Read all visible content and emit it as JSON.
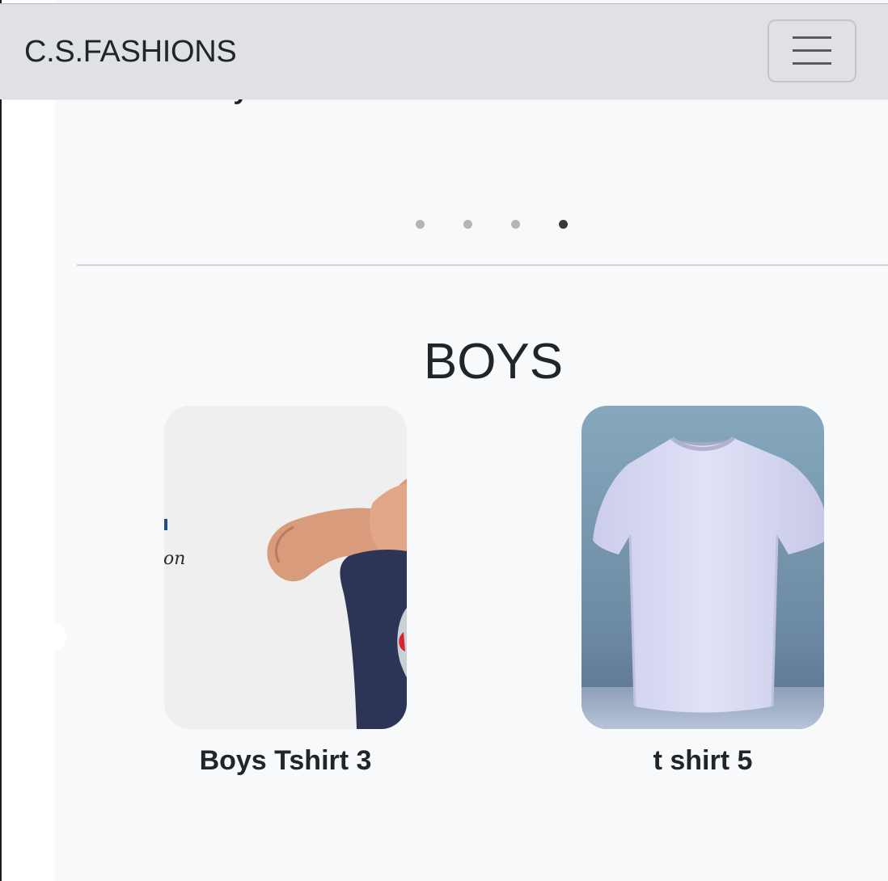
{
  "navbar": {
    "brand": "C.S.FASHIONS",
    "toggle_icon": "hamburger-menu-icon"
  },
  "carousel": {
    "peek_titles": [
      "Boys Tshirt 3",
      "t shirt 5"
    ],
    "dot_count": 4,
    "active_index": 3
  },
  "section": {
    "title": "BOYS",
    "products": [
      {
        "title": "Boys Tshirt 3",
        "image_icon": "boy-in-navy-tshirt-photo"
      },
      {
        "title": "t shirt 5",
        "image_icon": "white-tshirt-mockup-photo"
      }
    ]
  },
  "colors": {
    "navbar_bg": "#dfe1e5",
    "page_bg": "#f8f9fa",
    "text": "#212529",
    "dot_inactive": "#b5b5b5",
    "dot_active": "#3a3a3a"
  }
}
